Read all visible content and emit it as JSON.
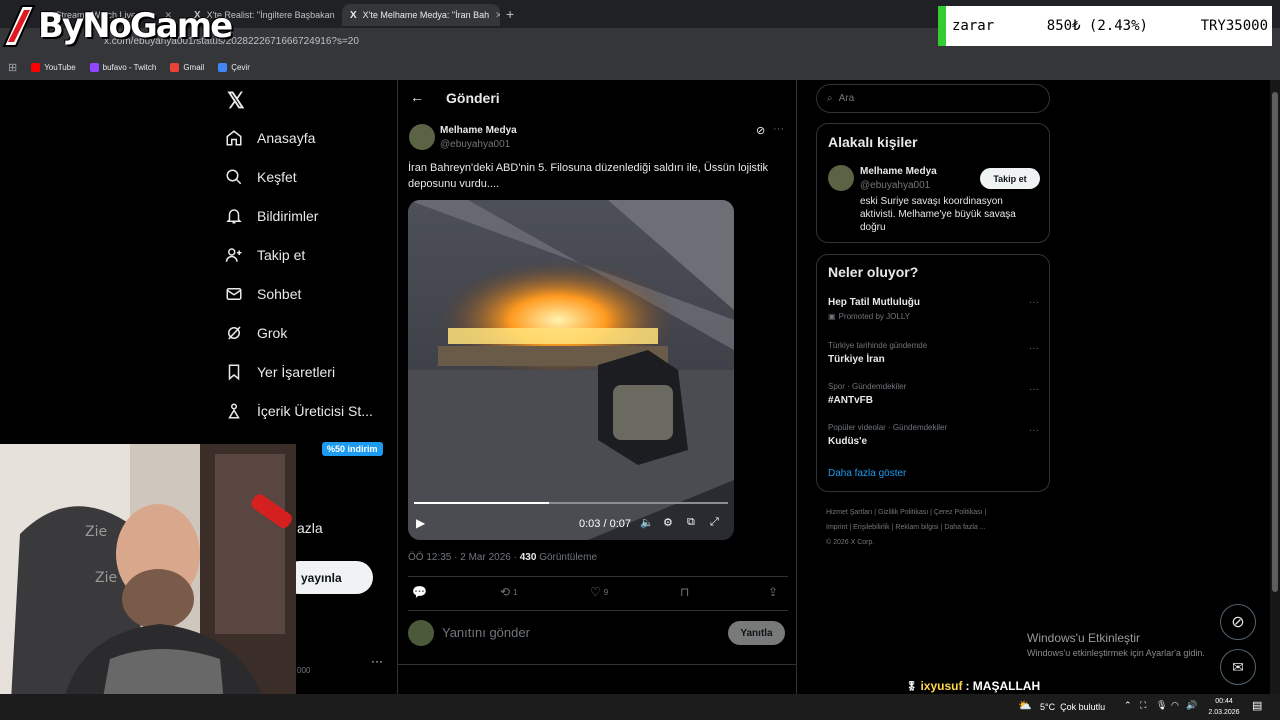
{
  "browser": {
    "tabs": [
      {
        "label": "o Stream | Watch Live"
      },
      {
        "label": "X'te Realist: \"İngiltere Başbakan"
      },
      {
        "label": "X'te Melhame Medya: \"İran Bah"
      }
    ],
    "url": "x.com/ebuyahya001/status/2028222671666724916?s=20",
    "bookmarks": [
      {
        "label": "YouTube",
        "color": "#ff0000"
      },
      {
        "label": "bufavo - Twitch",
        "color": "#9146ff"
      },
      {
        "label": "Gmail",
        "color": "#ea4335"
      },
      {
        "label": "Çevir",
        "color": "#4285f4"
      }
    ]
  },
  "overlay": {
    "logo_text": "ByNoGame",
    "ticker": {
      "label": "zarar",
      "change": "850₺ (2.43%)",
      "total": "TRY35000"
    }
  },
  "nav": {
    "items": [
      {
        "label": "Anasayfa",
        "icon": "home-icon"
      },
      {
        "label": "Keşfet",
        "icon": "search-icon"
      },
      {
        "label": "Bildirimler",
        "icon": "bell-icon"
      },
      {
        "label": "Takip et",
        "icon": "follow-icon"
      },
      {
        "label": "Sohbet",
        "icon": "mail-icon"
      },
      {
        "label": "Grok",
        "icon": "grok-icon"
      },
      {
        "label": "Yer İşaretleri",
        "icon": "bookmark-icon"
      },
      {
        "label": "İçerik Üreticisi St...",
        "icon": "creator-icon"
      }
    ],
    "premium_badge": "%50 indirim",
    "more_label": "azla",
    "post_button": "yayınla",
    "account_partial": "000"
  },
  "post": {
    "header_title": "Gönderi",
    "author_name": "Melhame Medya",
    "author_handle": "@ebuyahya001",
    "text": "İran Bahreyn'deki ABD'nin 5. Filosuna düzenlediği saldırı ile, Üssün lojistik deposunu vurdu....",
    "video": {
      "time": "0:03 / 0:07",
      "progress": 0.43
    },
    "meta_time": "ÖÖ 12:35 · 2 Mar 2026 ·",
    "views_count": "430",
    "views_label": "Görüntüleme",
    "retweets": "1",
    "likes": "9",
    "reply_placeholder": "Yanıtını gönder",
    "reply_button": "Yanıtla"
  },
  "sidebar": {
    "search_placeholder": "Ara",
    "related": {
      "title": "Alakalı kişiler",
      "name": "Melhame Medya",
      "handle": "@ebuyahya001",
      "follow_button": "Takip et",
      "bio": "eski Suriye savaşı koordinasyon aktivisti. Melhame'ye büyük savaşa doğru"
    },
    "trends": {
      "title": "Neler oluyor?",
      "items": [
        {
          "context": "",
          "name": "Hep Tatil Mutluluğu",
          "sub": "Promoted by JOLLY"
        },
        {
          "context": "Türkiye tarihinde gündemde",
          "name": "Türkiye İran",
          "sub": ""
        },
        {
          "context": "Spor · Gündemdekiler",
          "name": "#ANTvFB",
          "sub": ""
        },
        {
          "context": "Popüler videolar · Gündemdekiler",
          "name": "Kudüs'e",
          "sub": ""
        }
      ],
      "show_more": "Daha fazla göster"
    },
    "footer": [
      "Hizmet Şartları",
      "Gizlilik Politikası",
      "Çerez Politikası",
      "Imprint",
      "Erişilebilirlik",
      "Reklam bilgisi",
      "Daha fazla ...",
      "© 2026 X Corp."
    ]
  },
  "windows": {
    "activate_title": "Windows'u Etkinleştir",
    "activate_sub": "Windows'u etkinleştirmek için Ayarlar'a gidin.",
    "chat_user": "ixyusuf",
    "chat_msg": ": MAŞALLAH",
    "weather": "5°C  Çok bulutlu",
    "clock_time": "00:44",
    "clock_date": "2.03.2026"
  }
}
